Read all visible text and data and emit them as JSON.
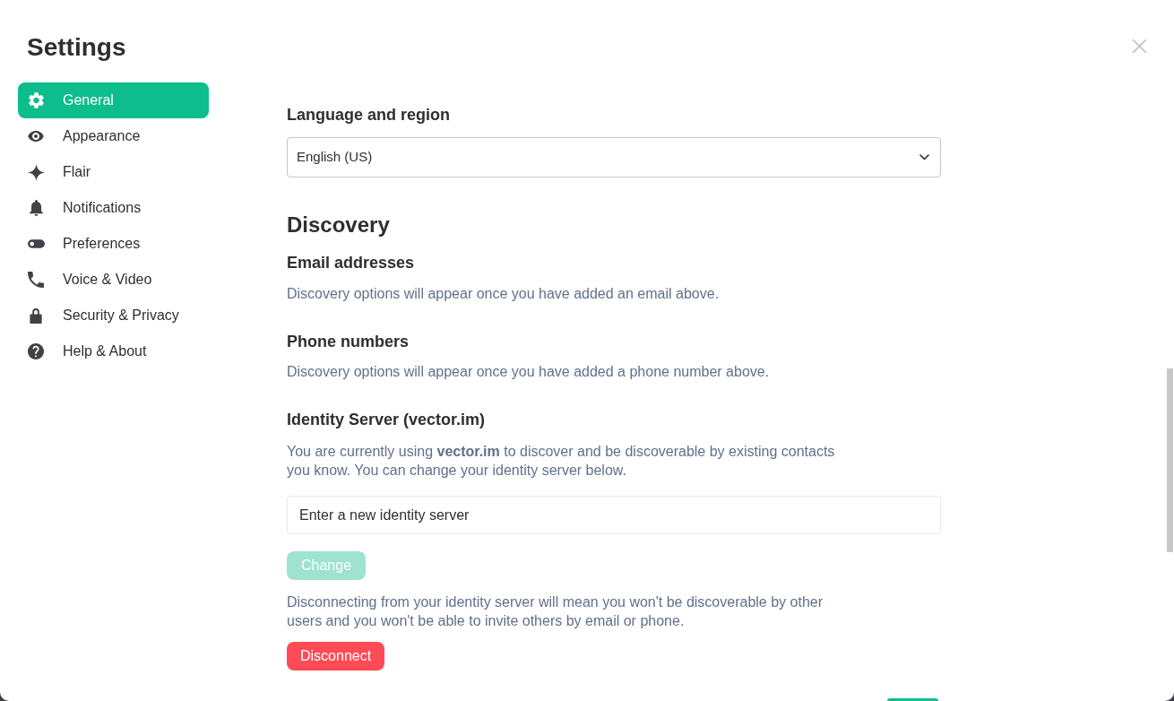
{
  "window": {
    "title": "Settings"
  },
  "sidebar": {
    "items": [
      {
        "label": "General",
        "selected": true
      },
      {
        "label": "Appearance",
        "selected": false
      },
      {
        "label": "Flair",
        "selected": false
      },
      {
        "label": "Notifications",
        "selected": false
      },
      {
        "label": "Preferences",
        "selected": false
      },
      {
        "label": "Voice & Video",
        "selected": false
      },
      {
        "label": "Security & Privacy",
        "selected": false
      },
      {
        "label": "Help & About",
        "selected": false
      }
    ]
  },
  "language_region": {
    "heading": "Language and region",
    "dropdown": {
      "value": "English (US)"
    }
  },
  "discovery": {
    "heading": "Discovery",
    "subsections": [
      {
        "heading": "Email addresses",
        "description": "Discovery options will appear once you have added an email above."
      },
      {
        "heading": "Phone numbers",
        "description": "Discovery options will appear once you have added a phone number above."
      }
    ]
  },
  "identity_server": {
    "heading": "Identity Server (vector.im)",
    "description": "You are currently using **vector.im** to discover and be discoverable by existing contacts you know. You can change your identity server below.",
    "input": {
      "placeholder": "Enter a new identity server"
    },
    "change_button": {
      "label": "Change",
      "disabled": true
    },
    "disconnect_note": "Disconnecting from your identity server will mean you won't be discoverable by other users and you won't be able to invite others by email or phone.",
    "disconnect_button": {
      "label": "Disconnect"
    }
  }
}
